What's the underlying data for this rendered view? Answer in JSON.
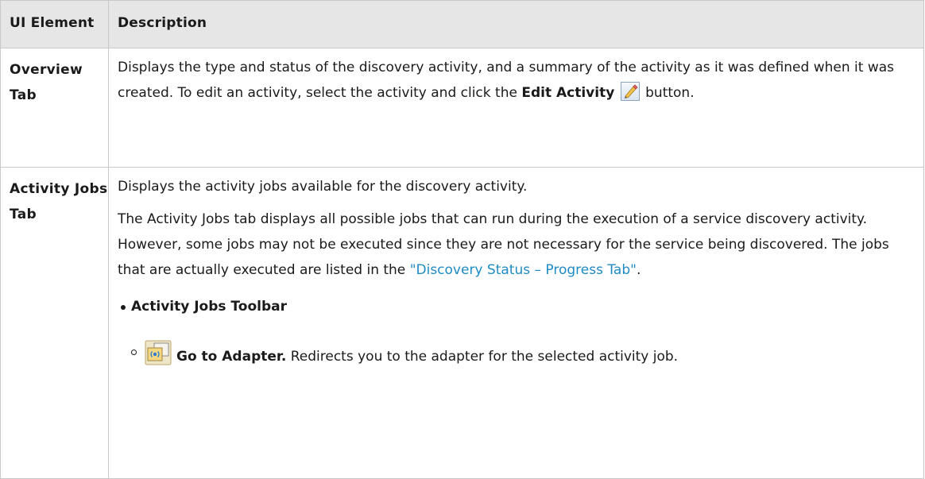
{
  "table": {
    "header": {
      "col_element": "UI Element",
      "col_description": "Description"
    },
    "rows": [
      {
        "element": "Overview Tab",
        "description": {
          "text_a": "Displays the type and status of the discovery activity, and a summary of the activity as it was defined when it was created. To edit an activity, select the activity and click the ",
          "bold_label": "Edit Activity",
          "text_b": " button.",
          "icon": "pencil-edit-icon"
        }
      },
      {
        "element": "Activity Jobs Tab",
        "description": {
          "para1": "Displays the activity jobs available for the discovery activity.",
          "para2_text": "The Activity Jobs tab displays all possible jobs that can run during the execution of a service discovery activity. However, some jobs may not be executed since they are not necessary for the service being discovered. The jobs that are actually executed are listed in the ",
          "para2_link": "\"Discovery Status – Progress Tab\"",
          "para2_end": ".",
          "bullet_heading": "Activity Jobs Toolbar",
          "sub_item": {
            "icon": "go-to-adapter-icon",
            "label": "Go to Adapter.",
            "text": " Redirects you to the adapter for the selected activity job."
          }
        }
      }
    ]
  },
  "colors": {
    "header_bg": "#e6e6e6",
    "border": "#c9c9c9",
    "link": "#1e8bc3"
  }
}
